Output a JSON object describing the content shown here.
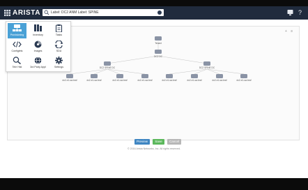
{
  "header": {
    "logo": "ARISTA",
    "search_value": "Label: DC2 ANM Label: SPINE",
    "help_label": "?",
    "colors": {
      "header_bg": "#202b3d",
      "accent": "#4aa1d6"
    },
    "icons": [
      "apps-grid-icon",
      "search-icon",
      "clear-icon",
      "device-icon"
    ]
  },
  "app_menu": {
    "items": [
      {
        "label": "Provisioning",
        "icon": "provisioning-icon",
        "active": true
      },
      {
        "label": "Inventory",
        "icon": "inventory-icon",
        "active": false
      },
      {
        "label": "Tasks",
        "icon": "tasks-icon",
        "active": false
      },
      {
        "label": "Configlets",
        "icon": "configlets-icon",
        "active": false
      },
      {
        "label": "Images",
        "icon": "images-icon",
        "active": false
      },
      {
        "label": "SDU",
        "icon": "sdu-icon",
        "active": false
      },
      {
        "label": "Tele Hist",
        "icon": "telemetry-icon",
        "active": false
      },
      {
        "label": "3rd Party Appl",
        "icon": "apps-icon",
        "active": false
      },
      {
        "label": "Settings",
        "icon": "settings-icon",
        "active": false
      }
    ]
  },
  "topology": {
    "root": {
      "label": "Tenant"
    },
    "level1": {
      "label": "DC2 DC"
    },
    "level2": [
      {
        "label": "DC2 SPINE DC"
      },
      {
        "label": "DC2 SPINE DC"
      }
    ],
    "leaves": [
      {
        "label": "dc2-e1-sw-leaf"
      },
      {
        "label": "dc2-e1-sw-leaf"
      },
      {
        "label": "dc2-e1-sw-leaf"
      },
      {
        "label": "dc2-e1-sw-leaf"
      },
      {
        "label": "dc2-e1-sw-leaf"
      },
      {
        "label": "dc2-e1-sw-leaf"
      },
      {
        "label": "dc2-e1-sw-leaf"
      },
      {
        "label": "dc2-e1-sw-leaf"
      }
    ],
    "tools": "+ ≡"
  },
  "actions": {
    "preview": "Preview",
    "save": "Save",
    "cancel": "Cancel"
  },
  "footer": "© 2016 Arista Networks, Inc. All rights reserved."
}
